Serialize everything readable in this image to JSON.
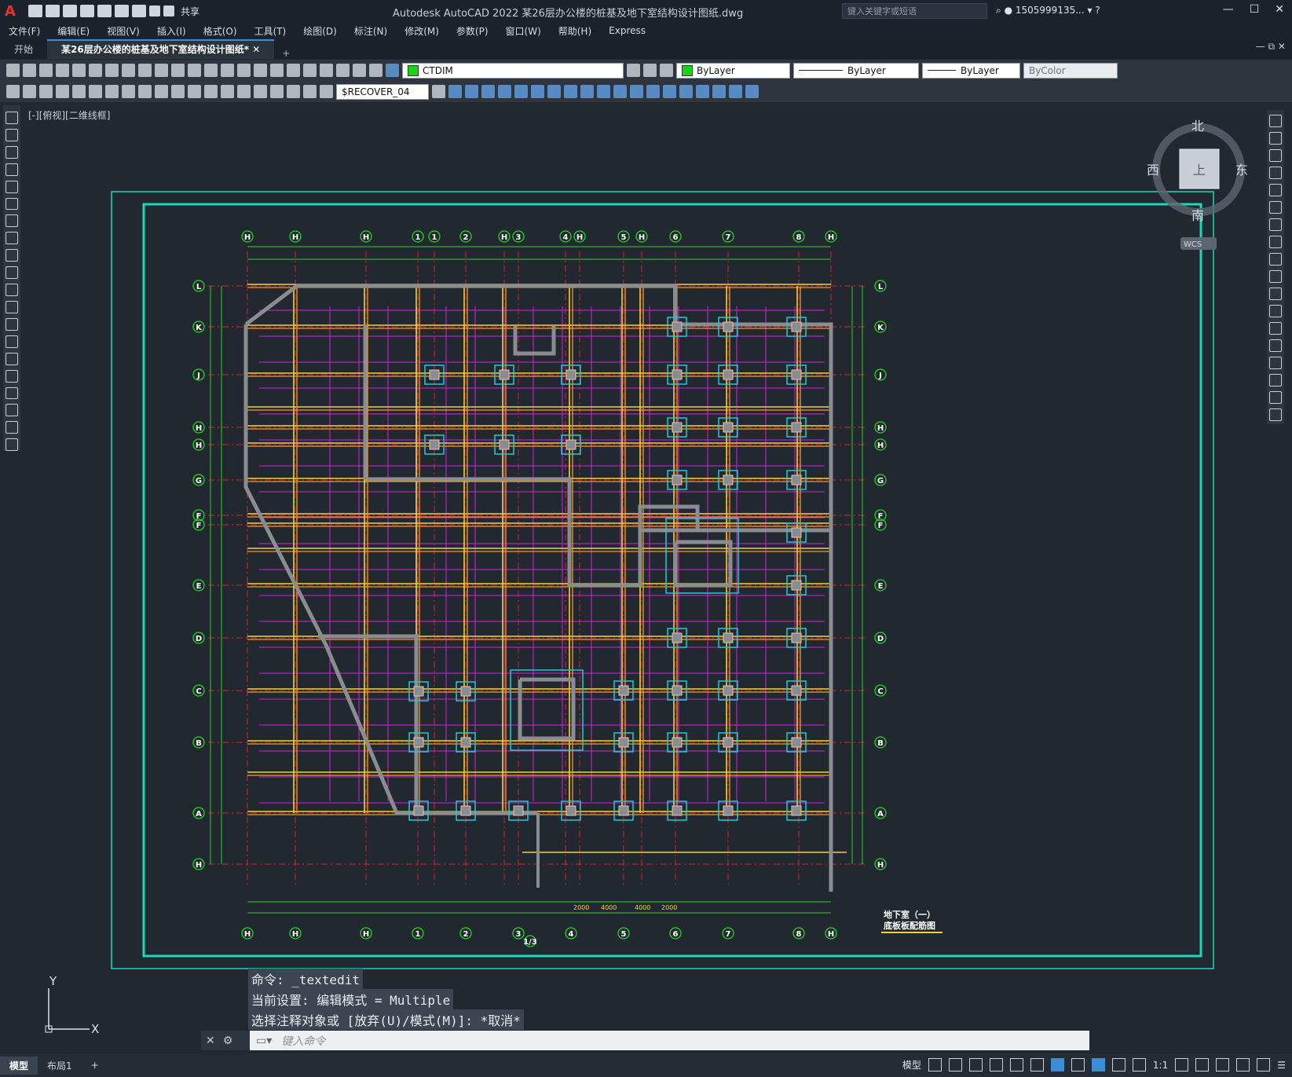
{
  "app": {
    "title": "Autodesk AutoCAD 2022    某26层办公楼的桩基及地下室结构设计图纸.dwg",
    "share_label": "共享",
    "search_placeholder": "键入关键字或短语",
    "user": "1505999135..."
  },
  "menu": [
    "文件(F)",
    "编辑(E)",
    "视图(V)",
    "插入(I)",
    "格式(O)",
    "工具(T)",
    "绘图(D)",
    "标注(N)",
    "修改(M)",
    "参数(P)",
    "窗口(W)",
    "帮助(H)",
    "Express"
  ],
  "tabs": [
    {
      "label": "开始",
      "active": false
    },
    {
      "label": "某26层办公楼的桩基及地下室结构设计图纸*",
      "active": true
    }
  ],
  "toolbar": {
    "layer": "CTDIM",
    "color": "ByLayer",
    "linetype": "ByLayer",
    "lineweight": "ByLayer",
    "plotstyle": "ByColor",
    "dimstyle": "$RECOVER_04"
  },
  "viewport": {
    "label": "[-][俯视][二维线框]",
    "viewcube": {
      "north": "北",
      "south": "南",
      "east": "东",
      "west": "西",
      "face": "上",
      "wcs": "WCS"
    },
    "ucs": {
      "x": "X",
      "y": "Y"
    }
  },
  "drawing": {
    "top_axes": [
      "H",
      "H",
      "H",
      "1",
      "1",
      "2",
      "H",
      "3",
      "4",
      "H",
      "5",
      "H",
      "6",
      "7",
      "8",
      "H"
    ],
    "bottom_axes": [
      "H",
      "H",
      "H",
      "1",
      "2",
      "3",
      "4",
      "5",
      "6",
      "7",
      "8",
      "H"
    ],
    "bottom_sub": "1/3",
    "row_axes": [
      "L",
      "K",
      "J",
      "H",
      "H",
      "G",
      "F",
      "F",
      "E",
      "D",
      "C",
      "B",
      "A",
      "H"
    ],
    "dims": [
      "2000",
      "4000",
      "4000",
      "2000"
    ],
    "title_line1": "地下室（一）",
    "title_line2": "底板板配筋图"
  },
  "command": {
    "line1": "命令: _textedit",
    "line2": "当前设置: 编辑模式 = Multiple",
    "line3": "选择注释对象或 [放弃(U)/模式(M)]: *取消*",
    "placeholder": "键入命令"
  },
  "status": {
    "layouts": [
      "模型",
      "布局1"
    ],
    "model_label": "模型",
    "scale": "1:1"
  },
  "colors": {
    "background": "#212830",
    "frame": "#19d9b9",
    "axis_green": "#22d620",
    "grid_red": "#e0222a",
    "beam_yellow": "#ecd633",
    "beam_orange": "#f59a25",
    "rebar_magenta": "#d320d6",
    "column_cyan": "#22c8d6",
    "wall_gray": "#8a8d90"
  }
}
